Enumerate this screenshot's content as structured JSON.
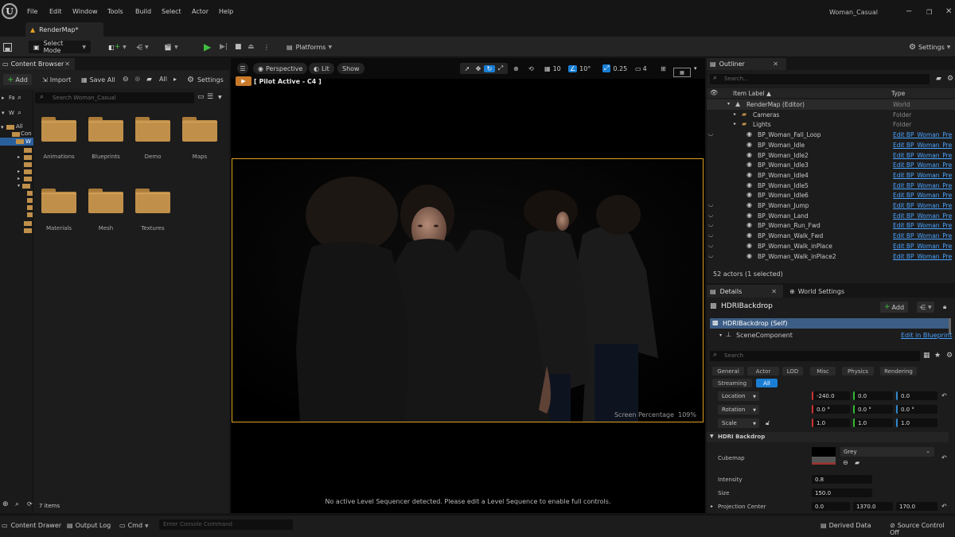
{
  "menu": {
    "items": [
      "File",
      "Edit",
      "Window",
      "Tools",
      "Build",
      "Select",
      "Actor",
      "Help"
    ],
    "project": "Woman_Casual"
  },
  "tabs": {
    "level": "RenderMap*"
  },
  "toolbar": {
    "select_mode": "Select Mode",
    "platforms": "Platforms",
    "settings": "Settings"
  },
  "content_browser": {
    "title": "Content Browser",
    "add": "Add",
    "import": "Import",
    "save_all": "Save All",
    "path_all": "All",
    "settings": "Settings",
    "search_placeholder": "Search Woman_Casual",
    "tree_fa": "Fa",
    "tree_w": "W",
    "tree_all": "All",
    "tree_con": "Con",
    "tree_w2": "W",
    "folders": [
      "Animations",
      "Blueprints",
      "Demo",
      "Maps",
      "Materials",
      "Mesh",
      "Textures"
    ],
    "item_count": "7 items"
  },
  "viewport": {
    "perspective": "Perspective",
    "lit": "Lit",
    "show": "Show",
    "grid_value": "10",
    "angle_value": "10°",
    "scale_value": "0.25",
    "camera_speed": "4",
    "pilot_label": "[ Pilot Active - C4 ]",
    "screen_percentage_label": "Screen Percentage",
    "screen_percentage_value": "109%",
    "sequencer_message": "No active Level Sequencer detected. Please edit a Level Sequence to enable full controls."
  },
  "outliner": {
    "title": "Outliner",
    "search_placeholder": "Search...",
    "col_label": "Item Label ▲",
    "col_type": "Type",
    "rows": [
      {
        "label": "RenderMap (Editor)",
        "type": "World"
      },
      {
        "label": "Cameras",
        "type": "Folder"
      },
      {
        "label": "Lights",
        "type": "Folder"
      },
      {
        "label": "BP_Woman_Fall_Loop",
        "type": "Edit BP_Woman_Pre"
      },
      {
        "label": "BP_Woman_Idle",
        "type": "Edit BP_Woman_Pre"
      },
      {
        "label": "BP_Woman_Idle2",
        "type": "Edit BP_Woman_Pre"
      },
      {
        "label": "BP_Woman_Idle3",
        "type": "Edit BP_Woman_Pre"
      },
      {
        "label": "BP_Woman_Idle4",
        "type": "Edit BP_Woman_Pre"
      },
      {
        "label": "BP_Woman_Idle5",
        "type": "Edit BP_Woman_Pre"
      },
      {
        "label": "BP_Woman_Idle6",
        "type": "Edit BP_Woman_Pre"
      },
      {
        "label": "BP_Woman_Jump",
        "type": "Edit BP_Woman_Pre"
      },
      {
        "label": "BP_Woman_Land",
        "type": "Edit BP_Woman_Pre"
      },
      {
        "label": "BP_Woman_Run_Fwd",
        "type": "Edit BP_Woman_Pre"
      },
      {
        "label": "BP_Woman_Walk_Fwd",
        "type": "Edit BP_Woman_Pre"
      },
      {
        "label": "BP_Woman_Walk_inPlace",
        "type": "Edit BP_Woman_Pre"
      },
      {
        "label": "BP_Woman_Walk_inPlace2",
        "type": "Edit BP_Woman_Pre"
      }
    ],
    "actor_count": "52 actors (1 selected)"
  },
  "details": {
    "title": "Details",
    "world_settings": "World Settings",
    "actor_name": "HDRIBackdrop",
    "add": "Add",
    "self_label": "HDRIBackdrop (Self)",
    "scene_component": "SceneComponent",
    "edit_in_blueprint": "Edit in Blueprint",
    "search_placeholder": "Search",
    "filters": [
      "General",
      "Actor",
      "LOD",
      "Misc",
      "Physics",
      "Rendering",
      "Streaming",
      "All"
    ],
    "location_label": "Location",
    "location": [
      "-240.0",
      "0.0",
      "0.0"
    ],
    "rotation_label": "Rotation",
    "rotation": [
      "0.0 °",
      "0.0 °",
      "0.0 °"
    ],
    "scale_label": "Scale",
    "scale": [
      "1.0",
      "1.0",
      "1.0"
    ],
    "section": "HDRI Backdrop",
    "cubemap_label": "Cubemap",
    "cubemap_value": "Grey",
    "intensity_label": "Intensity",
    "intensity": "0.8",
    "size_label": "Size",
    "size": "150.0",
    "projection_label": "Projection Center",
    "projection": [
      "0.0",
      "1370.0",
      "170.0"
    ]
  },
  "statusbar": {
    "content_drawer": "Content Drawer",
    "output_log": "Output Log",
    "cmd": "Cmd",
    "console_placeholder": "Enter Console Command",
    "derived_data": "Derived Data",
    "source_control": "Source Control Off"
  },
  "colors": {
    "accent_blue": "#1a7fd4",
    "selection_orange": "#e0a020",
    "folder": "#c0904a",
    "play_green": "#3fbf3f"
  }
}
